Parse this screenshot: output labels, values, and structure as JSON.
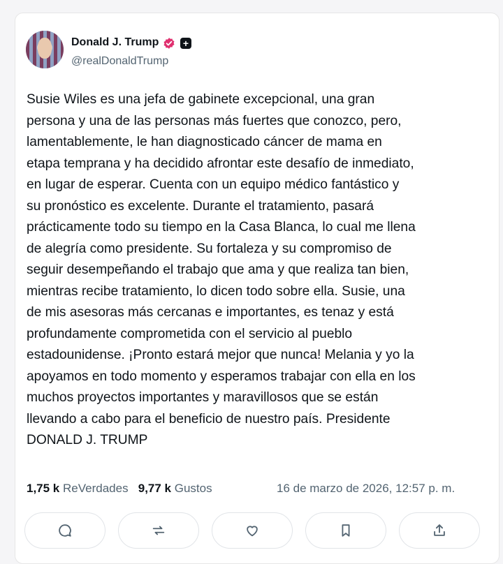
{
  "post": {
    "author_name": "Donald J. Trump",
    "handle": "@realDonaldTrump",
    "body_lines": [
      "Susie Wiles es una jefa de gabinete excepcional, una gran",
      "persona y una de las personas más fuertes que conozco, pero,",
      "lamentablemente, le han diagnosticado cáncer de mama en",
      "etapa temprana y ha decidido afrontar este desafío de inmediato,",
      "en lugar de esperar. Cuenta con un equipo médico fantástico y",
      "su pronóstico es excelente. Durante el tratamiento, pasará",
      "prácticamente todo su tiempo en la Casa Blanca, lo cual me llena",
      "de alegría como presidente. Su fortaleza y su compromiso de",
      "seguir desempeñando el trabajo que ama y que realiza tan bien,",
      "mientras recibe tratamiento, lo dicen todo sobre ella. Susie, una",
      "de mis asesoras más cercanas e importantes, es tenaz y está",
      "profundamente comprometida con el servicio al pueblo",
      "estadounidense. ¡Pronto estará mejor que nunca! Melania y yo la",
      "apoyamos en todo momento y esperamos trabajar con ella en los",
      "muchos proyectos importantes y maravillosos que se están",
      "llevando a cabo para el beneficio de nuestro país. Presidente",
      "DONALD J. TRUMP"
    ],
    "retruths_count": "1,75 k",
    "retruths_label": "ReVerdades",
    "likes_count": "9,77 k",
    "likes_label": "Gustos",
    "timestamp": "16 de marzo de 2026, 12:57 p. m."
  },
  "icons": {
    "verified": "verified-badge-icon",
    "affiliation": "affiliation-plus-icon",
    "actions": [
      "reply-icon",
      "retruth-icon",
      "like-icon",
      "bookmark-icon",
      "share-icon"
    ]
  },
  "colors": {
    "verified_badge": "#e0306f",
    "muted_text": "#536471",
    "text": "#0f1419"
  }
}
